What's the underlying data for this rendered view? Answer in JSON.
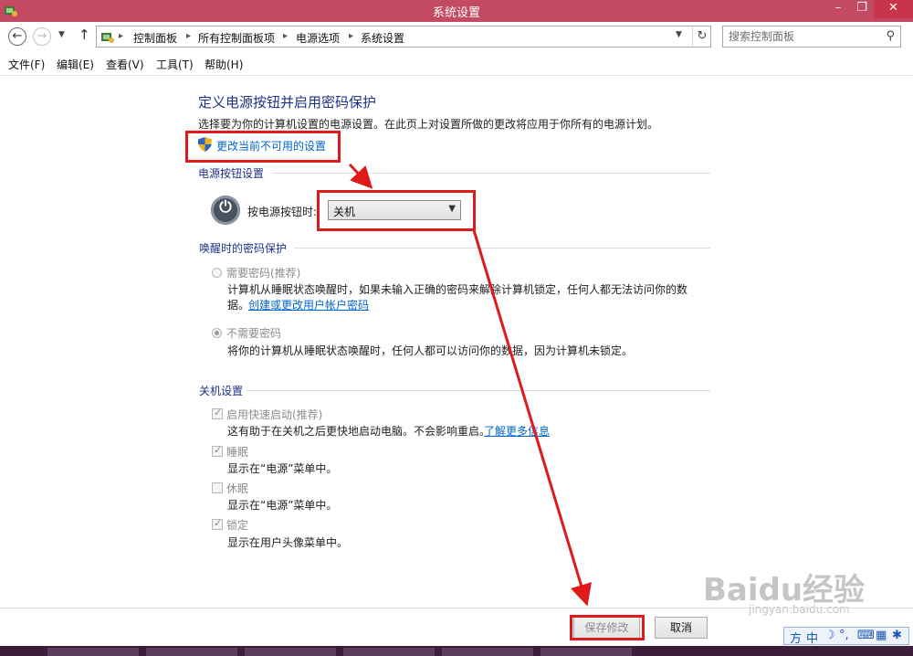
{
  "window": {
    "title": "系统设置"
  },
  "address": {
    "breadcrumbs": [
      "控制面板",
      "所有控制面板项",
      "电源选项",
      "系统设置"
    ],
    "search_placeholder": "搜索控制面板"
  },
  "menu": [
    "文件(F)",
    "编辑(E)",
    "查看(V)",
    "工具(T)",
    "帮助(H)"
  ],
  "page": {
    "title": "定义电源按钮并启用密码保护",
    "description": "选择要为你的计算机设置的电源设置。在此页上对设置所做的更改将应用于你所有的电源计划。",
    "admin_link": "更改当前不可用的设置",
    "power_section": "电源按钮设置",
    "power_label": "按电源按钮时:",
    "power_value": "关机",
    "wake_section": "唤醒时的密码保护",
    "require_password": {
      "label": "需要密码(推荐)",
      "desc1": "计算机从睡眠状态唤醒时，如果未输入正确的密码来解除计算机锁定，任何人都无法访问你的数",
      "desc2": "据。",
      "link": "创建或更改用户帐户密码",
      "selected": false
    },
    "no_password": {
      "label": "不需要密码",
      "desc": "将你的计算机从睡眠状态唤醒时，任何人都可以访问你的数据，因为计算机未锁定。",
      "selected": true
    },
    "shutdown_section": "关机设置",
    "fast_startup": {
      "label": "启用快速启动(推荐)",
      "desc": "这有助于在关机之后更快地启动电脑。不会影响重启。",
      "link": "了解更多信息",
      "checked": true
    },
    "sleep": {
      "label": "睡眠",
      "desc": "显示在“电源”菜单中。",
      "checked": true
    },
    "hibernate": {
      "label": "休眠",
      "desc": "显示在“电源”菜单中。",
      "checked": false
    },
    "lock": {
      "label": "锁定",
      "desc": "显示在用户头像菜单中。",
      "checked": true
    }
  },
  "buttons": {
    "save": "保存修改",
    "cancel": "取消"
  },
  "ime": {
    "mode": "中"
  },
  "watermark": {
    "logo": "Baidu经验",
    "url": "jingyan.baidu.com"
  },
  "colors": {
    "titlebar": "#c44a63",
    "annotation": "#e01a1a",
    "link": "#0066cc",
    "heading": "#1e3287"
  }
}
